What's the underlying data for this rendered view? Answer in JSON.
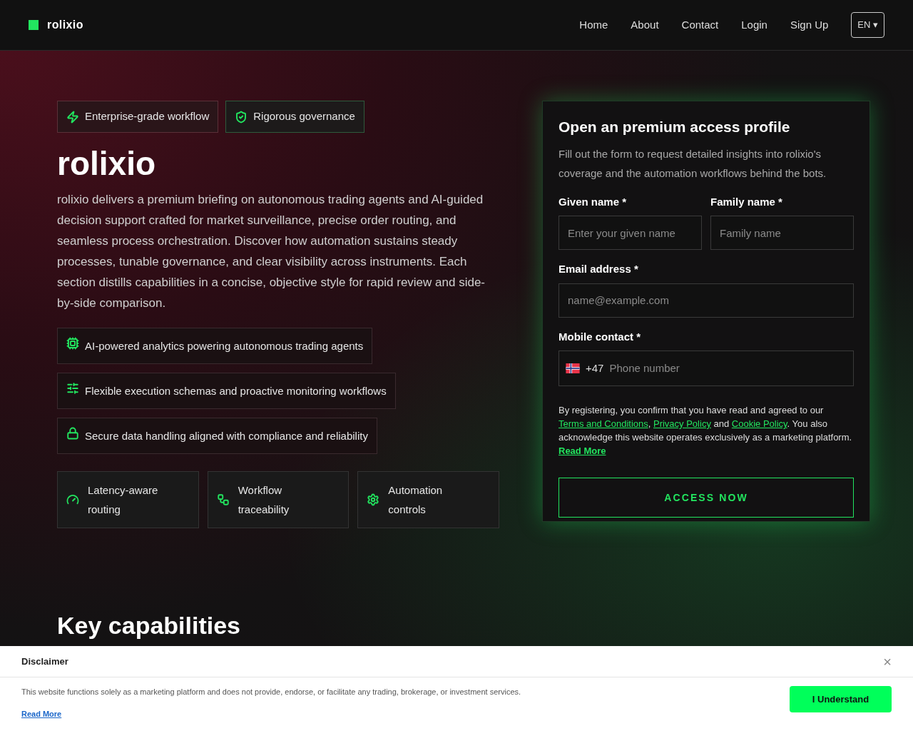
{
  "brand": "rolixio",
  "nav": [
    "Home",
    "About",
    "Contact",
    "Login",
    "Sign Up"
  ],
  "language": "EN ▾",
  "badges": [
    {
      "label": "Enterprise-grade workflow",
      "kind": "bolt"
    },
    {
      "label": "Rigorous governance",
      "kind": "shield"
    }
  ],
  "hero": {
    "title": "rolixio",
    "description": "rolixio delivers a premium briefing on autonomous trading agents and AI-guided decision support crafted for market surveillance, precise order routing, and seamless process orchestration. Discover how automation sustains steady processes, tunable governance, and clear visibility across instruments. Each section distills capabilities in a concise, objective style for rapid review and side-by-side comparison."
  },
  "features": [
    {
      "label": "AI-powered analytics powering autonomous trading agents",
      "kind": "chip"
    },
    {
      "label": "Flexible execution schemas and proactive monitoring workflows",
      "kind": "sliders"
    },
    {
      "label": "Secure data handling aligned with compliance and reliability",
      "kind": "lock"
    }
  ],
  "tiles": [
    {
      "label": "Latency-aware routing",
      "kind": "gauge"
    },
    {
      "label": "Workflow traceability",
      "kind": "flow"
    },
    {
      "label": "Automation controls",
      "kind": "gear"
    }
  ],
  "form": {
    "title": "Open an premium access profile",
    "subtitle": "Fill out the form to request detailed insights into rolixio's coverage and the automation workflows behind the bots.",
    "given_name": {
      "label": "Given name *",
      "placeholder": "Enter your given name"
    },
    "family_name": {
      "label": "Family name *",
      "placeholder": "Family name"
    },
    "email": {
      "label": "Email address *",
      "placeholder": "name@example.com"
    },
    "phone": {
      "label": "Mobile contact *",
      "code": "+47",
      "placeholder": "Phone number"
    },
    "consent": [
      "By registering, you confirm that you have read and agreed to our ",
      "Terms and Conditions",
      ", ",
      "Privacy Policy",
      " and ",
      "Cookie Policy",
      ". You also acknowledge this website operates exclusively as a marketing platform."
    ],
    "read_more": "Read More",
    "submit": "ACCESS NOW"
  },
  "next_section": "Key capabilities",
  "disclaimer": {
    "title": "Disclaimer",
    "close": "×",
    "text": "This website functions solely as a marketing platform and does not provide, endorse, or facilitate any trading, brokerage, or investment services.",
    "read_more": "Read More",
    "button": "I Understand"
  }
}
